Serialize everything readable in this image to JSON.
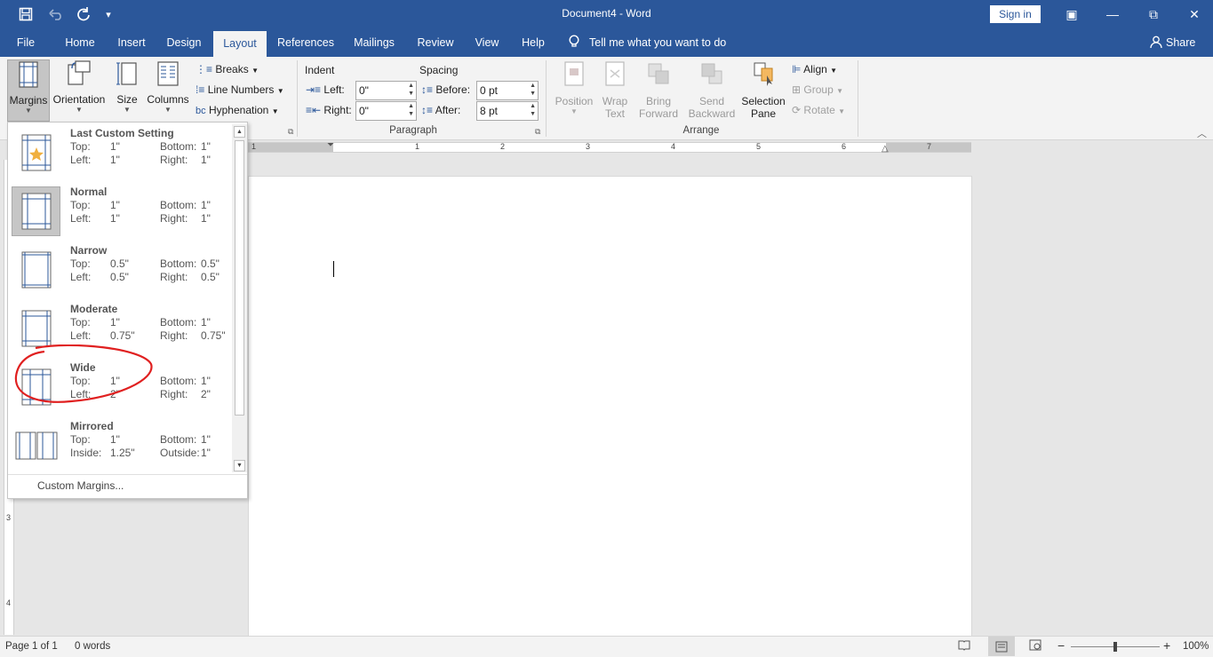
{
  "app": {
    "title": "Document4  -  Word",
    "sign_in": "Sign in",
    "quick_access": {
      "save_icon": "save-icon",
      "undo_icon": "undo-icon",
      "redo_icon": "redo-icon",
      "customize_icon": "customize-icon"
    },
    "window": {
      "ribbon_display": "▣",
      "minimize": "—",
      "restore": "⧉",
      "close": "✕"
    }
  },
  "tabs": [
    "File",
    "Home",
    "Insert",
    "Design",
    "Layout",
    "References",
    "Mailings",
    "Review",
    "View",
    "Help"
  ],
  "active_tab": "Layout",
  "tell_me": "Tell me what you want to do",
  "share": "Share",
  "ribbon": {
    "page_setup": {
      "margins": "Margins",
      "orientation": "Orientation",
      "size": "Size",
      "columns": "Columns",
      "breaks": "Breaks",
      "line_numbers": "Line Numbers",
      "hyphenation": "Hyphenation"
    },
    "paragraph": {
      "label": "Paragraph",
      "indent": "Indent",
      "spacing": "Spacing",
      "left_label": "Left:",
      "left_value": "0\"",
      "right_label": "Right:",
      "right_value": "0\"",
      "before_label": "Before:",
      "before_value": "0 pt",
      "after_label": "After:",
      "after_value": "8 pt"
    },
    "arrange": {
      "label": "Arrange",
      "position": "Position",
      "wrap_text_1": "Wrap",
      "wrap_text_2": "Text",
      "bring_forward_1": "Bring",
      "bring_forward_2": "Forward",
      "send_backward_1": "Send",
      "send_backward_2": "Backward",
      "selection_pane_1": "Selection",
      "selection_pane_2": "Pane",
      "align": "Align",
      "group": "Group",
      "rotate": "Rotate"
    }
  },
  "ruler": {
    "h_numbers": [
      "1",
      "1",
      "2",
      "3",
      "4",
      "5",
      "6",
      "7"
    ],
    "v_numbers": [
      "3",
      "4"
    ]
  },
  "margins_menu": {
    "options": [
      {
        "name": "Last Custom Setting",
        "a_label": "Top:",
        "a_val": "1\"",
        "b_label": "Bottom:",
        "b_val": "1\"",
        "c_label": "Left:",
        "c_val": "1\"",
        "d_label": "Right:",
        "d_val": "1\""
      },
      {
        "name": "Normal",
        "a_label": "Top:",
        "a_val": "1\"",
        "b_label": "Bottom:",
        "b_val": "1\"",
        "c_label": "Left:",
        "c_val": "1\"",
        "d_label": "Right:",
        "d_val": "1\""
      },
      {
        "name": "Narrow",
        "a_label": "Top:",
        "a_val": "0.5\"",
        "b_label": "Bottom:",
        "b_val": "0.5\"",
        "c_label": "Left:",
        "c_val": "0.5\"",
        "d_label": "Right:",
        "d_val": "0.5\""
      },
      {
        "name": "Moderate",
        "a_label": "Top:",
        "a_val": "1\"",
        "b_label": "Bottom:",
        "b_val": "1\"",
        "c_label": "Left:",
        "c_val": "0.75\"",
        "d_label": "Right:",
        "d_val": "0.75\""
      },
      {
        "name": "Wide",
        "a_label": "Top:",
        "a_val": "1\"",
        "b_label": "Bottom:",
        "b_val": "1\"",
        "c_label": "Left:",
        "c_val": "2\"",
        "d_label": "Right:",
        "d_val": "2\""
      },
      {
        "name": "Mirrored",
        "a_label": "Top:",
        "a_val": "1\"",
        "b_label": "Bottom:",
        "b_val": "1\"",
        "c_label": "Inside:",
        "c_val": "1.25\"",
        "d_label": "Outside:",
        "d_val": "1\""
      }
    ],
    "selected": "Normal",
    "custom": "Custom Margins..."
  },
  "status": {
    "page": "Page 1 of 1",
    "words": "0 words",
    "zoom": "100%",
    "zoom_minus": "−",
    "zoom_plus": "+"
  },
  "colors": {
    "accent": "#2b579a",
    "annotation": "#e02020"
  }
}
